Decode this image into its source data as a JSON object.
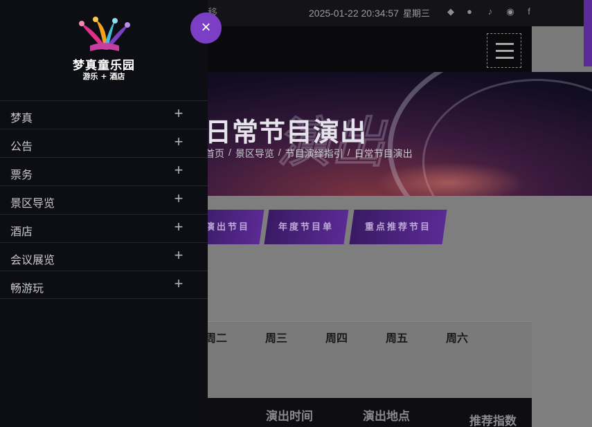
{
  "topbar": {
    "fragment": "移",
    "datetime": "2025-01-22 20:34:57",
    "weekday": "星期三",
    "social_icons": [
      "qq-icon",
      "wechat-icon",
      "tiktok-icon",
      "weibo-icon",
      "facebook-icon"
    ],
    "social_glyphs": {
      "qq": "◆",
      "wechat": "●",
      "tiktok": "♪",
      "weibo": "◉",
      "facebook": "f"
    }
  },
  "hero": {
    "title": "日常节目演出",
    "ghost_text": "演出",
    "breadcrumb": [
      "首页",
      "景区导览",
      "节目演绎指引",
      "日常节目演出"
    ],
    "separator": "/"
  },
  "tabs": [
    {
      "label": "演出节目"
    },
    {
      "label": "年度节目单"
    },
    {
      "label": "重点推荐节目"
    }
  ],
  "week": [
    "周二",
    "周三",
    "周四",
    "周五",
    "周六"
  ],
  "table": {
    "headers": [
      "演出时间",
      "演出地点",
      "推荐指数"
    ]
  },
  "drawer": {
    "logo_cn": "梦真童乐园",
    "logo_sub": "游乐 + 酒店",
    "close_glyph": "×",
    "plus_glyph": "+",
    "items": [
      {
        "label": "梦真"
      },
      {
        "label": "公告"
      },
      {
        "label": "票务"
      },
      {
        "label": "景区导览"
      },
      {
        "label": "酒店"
      },
      {
        "label": "会议展览"
      },
      {
        "label": "畅游玩"
      }
    ]
  },
  "colors": {
    "accent": "#7a3fc4",
    "drawer_bg": "#0d0e13",
    "tab_bg": "#4a2380"
  }
}
